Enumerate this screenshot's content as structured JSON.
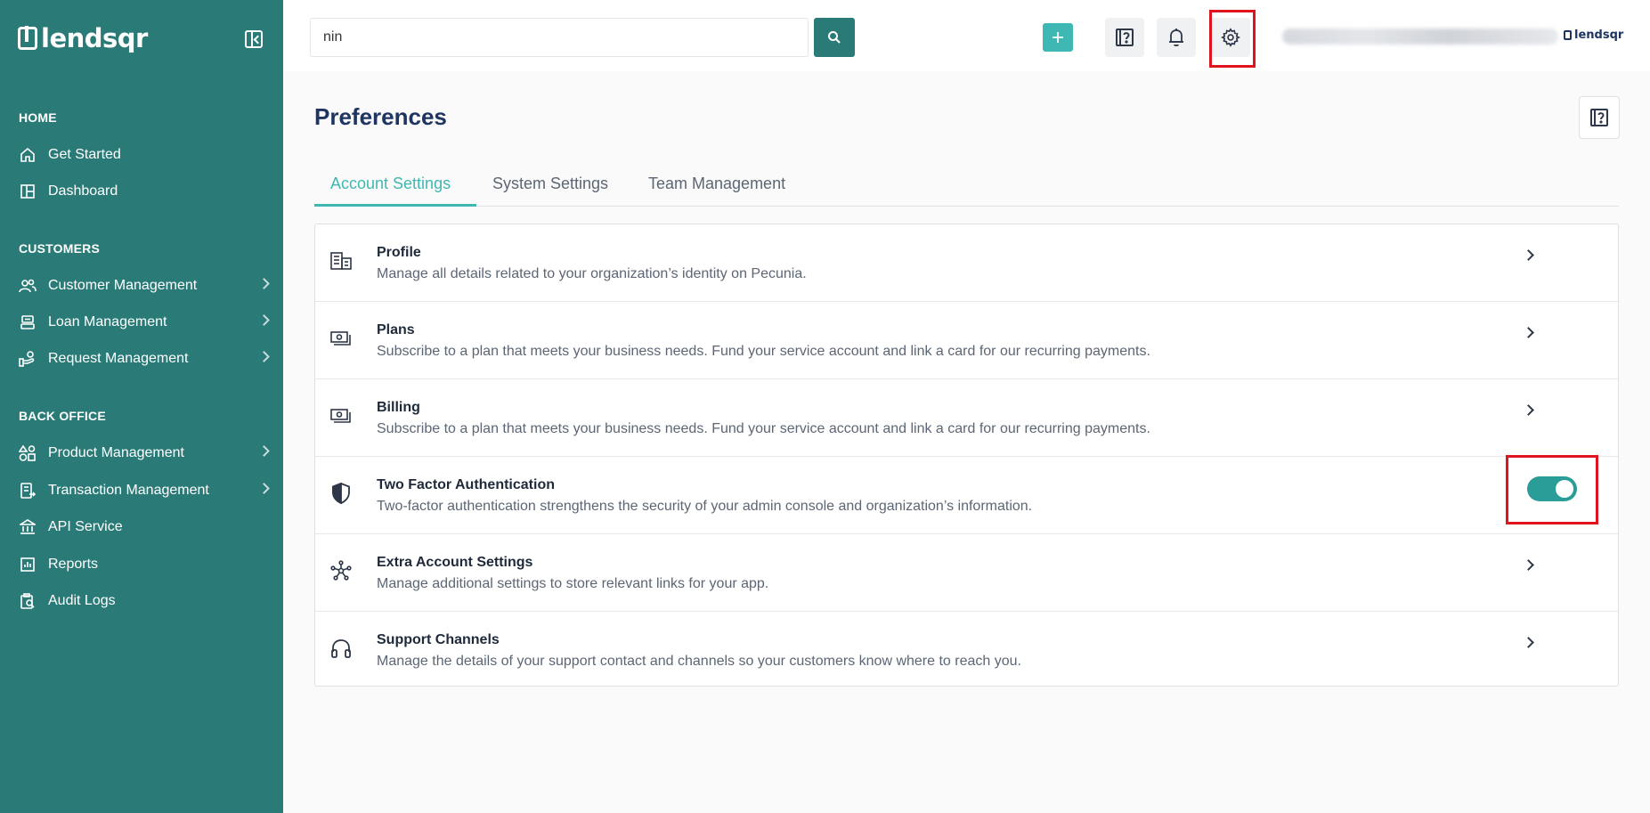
{
  "brand": {
    "name": "lendsqr",
    "accent": "#2a7b78",
    "highlight": "#3fb8b3"
  },
  "sidebar": {
    "sections": [
      {
        "title": "HOME",
        "items": [
          {
            "label": "Get Started",
            "icon": "home-icon",
            "has_chevron": false
          },
          {
            "label": "Dashboard",
            "icon": "dashboard-icon",
            "has_chevron": false
          }
        ]
      },
      {
        "title": "CUSTOMERS",
        "items": [
          {
            "label": "Customer Management",
            "icon": "users-icon",
            "has_chevron": true
          },
          {
            "label": "Loan Management",
            "icon": "loan-icon",
            "has_chevron": true
          },
          {
            "label": "Request Management",
            "icon": "request-icon",
            "has_chevron": true
          }
        ]
      },
      {
        "title": "BACK OFFICE",
        "items": [
          {
            "label": "Product Management",
            "icon": "product-icon",
            "has_chevron": true
          },
          {
            "label": "Transaction Management",
            "icon": "transaction-icon",
            "has_chevron": true
          },
          {
            "label": "API Service",
            "icon": "bank-icon",
            "has_chevron": false
          },
          {
            "label": "Reports",
            "icon": "reports-icon",
            "has_chevron": false
          },
          {
            "label": "Audit Logs",
            "icon": "audit-icon",
            "has_chevron": false
          }
        ]
      }
    ]
  },
  "topbar": {
    "search_value": "nin",
    "brand_small": "lendsqr"
  },
  "page": {
    "title": "Preferences",
    "tabs": [
      {
        "label": "Account Settings",
        "active": true
      },
      {
        "label": "System Settings",
        "active": false
      },
      {
        "label": "Team Management",
        "active": false
      }
    ],
    "settings": [
      {
        "title": "Profile",
        "description": "Manage all details related to your organization’s identity on Pecunia.",
        "icon": "building-icon",
        "control": "chevron"
      },
      {
        "title": "Plans",
        "description": "Subscribe to a plan that meets your business needs. Fund your service account and link a card for our recurring payments.",
        "icon": "money-icon",
        "control": "chevron"
      },
      {
        "title": "Billing",
        "description": "Subscribe to a plan that meets your business needs. Fund your service account and link a card for our recurring payments.",
        "icon": "money-icon",
        "control": "chevron"
      },
      {
        "title": "Two Factor Authentication",
        "description": "Two-factor authentication strengthens the security of your admin console and organization’s information.",
        "icon": "shield-icon",
        "control": "toggle",
        "enabled": true
      },
      {
        "title": "Extra Account Settings",
        "description": "Manage additional settings to store relevant links for your app.",
        "icon": "network-icon",
        "control": "chevron"
      },
      {
        "title": "Support Channels",
        "description": "Manage the details of your support contact and channels so your customers know where to reach you.",
        "icon": "headphones-icon",
        "control": "chevron"
      }
    ]
  }
}
